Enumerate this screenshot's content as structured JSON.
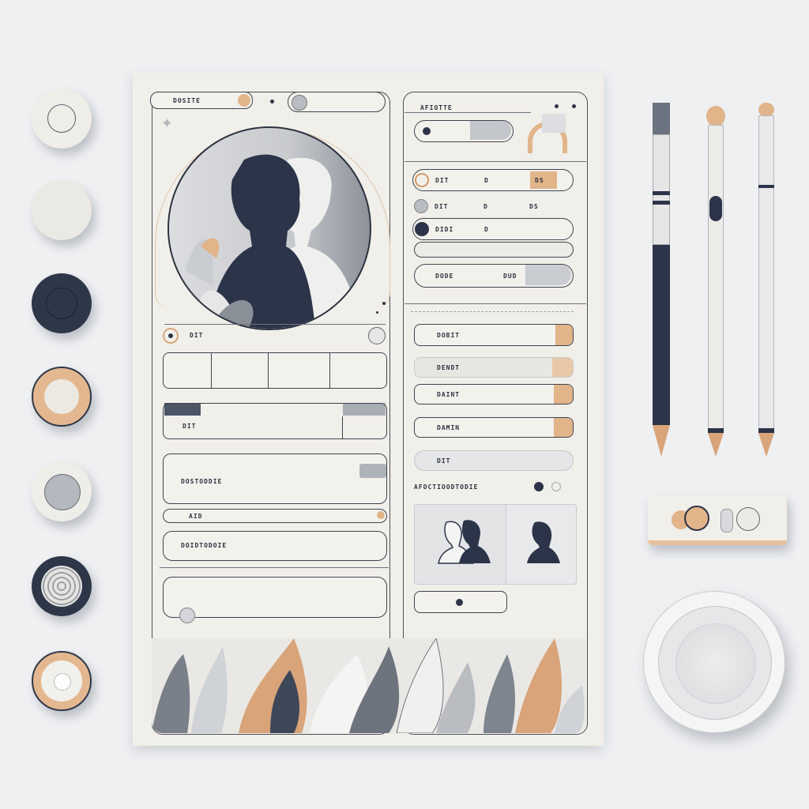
{
  "header": {
    "left_tag": "DOSITE",
    "right_tag": "AFIOTTE"
  },
  "left_column": {
    "row1_label": "DIT",
    "field2_label": "DIT",
    "field3_label": "DOSTODDIE",
    "field4_label": "AID",
    "field5_label": "DOIDTODOIE"
  },
  "right_column": {
    "row1": [
      "DIT",
      "D",
      "DS"
    ],
    "row2": [
      "DIT",
      "D",
      "DS"
    ],
    "row3": [
      "DIDI",
      "D"
    ],
    "row5": [
      "DODE",
      "DUD"
    ],
    "btn1": "DOBIT",
    "btn2": "DENDT",
    "btn3": "DAINT",
    "btn4": "DAMIN",
    "btn5": "DIT",
    "section_title": "AFOCTIOODTODIE"
  },
  "colors": {
    "accent_tan": "#e1b48a",
    "navy": "#2b3448",
    "paper": "#f1efe9"
  },
  "icons": [
    "profile-silhouette-icon",
    "leaf-icon",
    "pencil-icon",
    "button-disc-icon"
  ]
}
